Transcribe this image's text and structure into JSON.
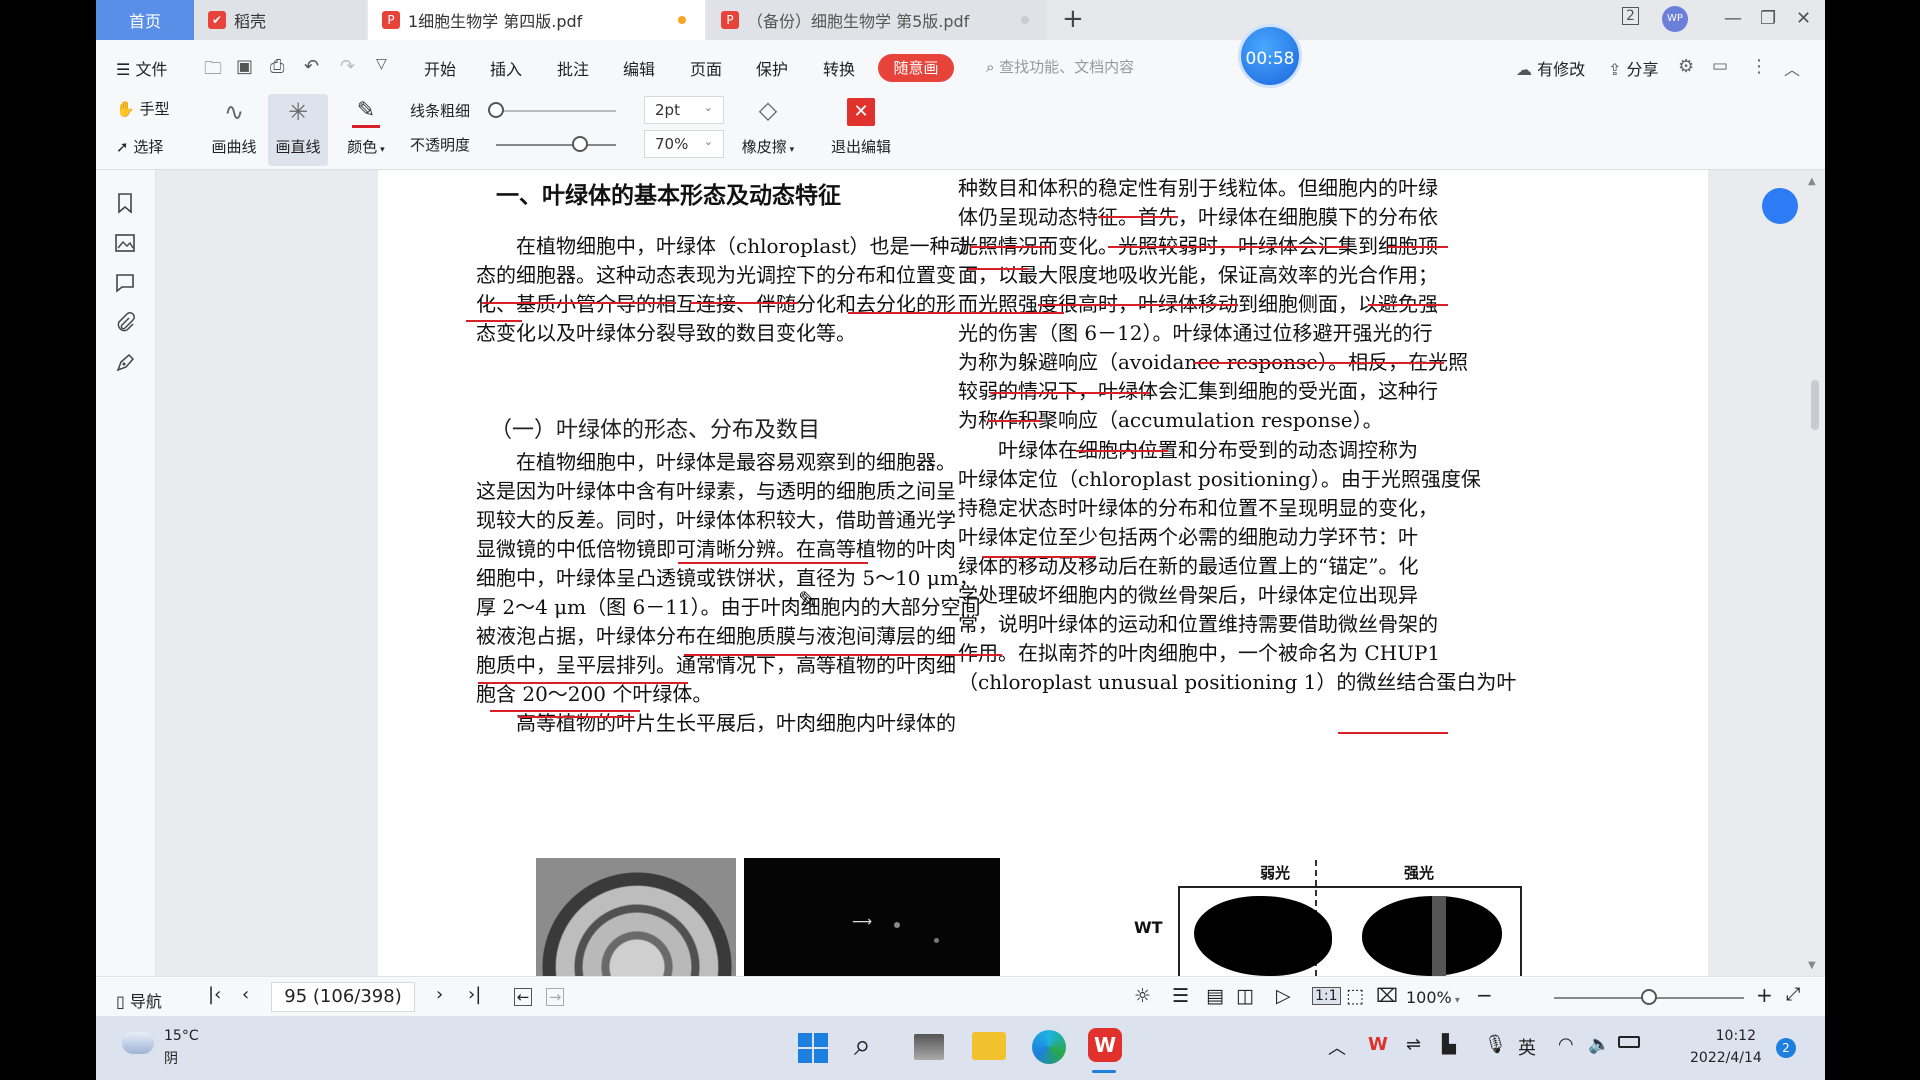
{
  "tabs": {
    "home": "首页",
    "daoke": "稻壳",
    "doc1": "1细胞生物学 第四版.pdf",
    "doc2": "（备份）细胞生物学 第5版.pdf"
  },
  "window": {
    "badge": "2"
  },
  "menu": {
    "file": "文件",
    "items": [
      "开始",
      "插入",
      "批注",
      "编辑",
      "页面",
      "保护",
      "转换"
    ],
    "active": "随意画",
    "search_placeholder": "查找功能、文档内容",
    "modified": "有修改",
    "share": "分享"
  },
  "timer": "00:58",
  "ribbon": {
    "hand": "手型",
    "select": "选择",
    "curve": "画曲线",
    "line": "画直线",
    "color": "颜色",
    "width_label": "线条粗细",
    "width_value": "2pt",
    "width_level": 0.0,
    "opacity_label": "不透明度",
    "opacity_value": "70%",
    "opacity_level": 0.7,
    "eraser": "橡皮擦",
    "exit": "退出编辑"
  },
  "doc": {
    "heading": "一、叶绿体的基本形态及动态特征",
    "left_para1": [
      "在植物细胞中，叶绿体（chloroplast）也是一种动",
      "态的细胞器。这种动态表现为光调控下的分布和位置变",
      "化、基质小管介导的相互连接、伴随分化和去分化的形",
      "态变化以及叶绿体分裂导致的数目变化等。"
    ],
    "subheading": "（一）叶绿体的形态、分布及数目",
    "left_para2": [
      "在植物细胞中，叶绿体是最容易观察到的细胞器。",
      "这是因为叶绿体中含有叶绿素，与透明的细胞质之间呈",
      "现较大的反差。同时，叶绿体体积较大，借助普通光学",
      "显微镜的中低倍物镜即可清晰分辨。在高等植物的叶肉",
      "细胞中，叶绿体呈凸透镜或铁饼状，直径为 5～10 μm，",
      "厚 2～4 μm（图 6－11）。由于叶肉细胞内的大部分空间",
      "被液泡占据，叶绿体分布在细胞质膜与液泡间薄层的细",
      "胞质中，呈平层排列。通常情况下，高等植物的叶肉细",
      "胞含 20～200 个叶绿体。",
      "高等植物的叶片生长平展后，叶肉细胞内叶绿体的"
    ],
    "right_para1": [
      "种数目和体积的稳定性有别于线粒体。但细胞内的叶绿",
      "体仍呈现动态特征。首先，叶绿体在细胞膜下的分布依",
      "光照情况而变化。光照较弱时，叶绿体会汇集到细胞顶",
      "面，以最大限度地吸收光能，保证高效率的光合作用；",
      "而光照强度很高时，叶绿体移动到细胞侧面，以避免强",
      "光的伤害（图 6－12）。叶绿体通过位移避开强光的行",
      "为称为躲避响应（avoidance response）。相反，在光照",
      "较弱的情况下，叶绿体会汇集到细胞的受光面，这种行",
      "为称作积聚响应（accumulation response）。"
    ],
    "right_para2": [
      "叶绿体在细胞内位置和分布受到的动态调控称为",
      "叶绿体定位（chloroplast positioning）。由于光照强度保",
      "持稳定状态时叶绿体的分布和位置不呈现明显的变化，",
      "叶绿体定位至少包括两个必需的细胞动力学环节：叶",
      "绿体的移动及移动后在新的最适位置上的“锚定”。化",
      "学处理破坏细胞内的微丝骨架后，叶绿体定位出现异",
      "常，说明叶绿体的运动和位置维持需要借助微丝骨架的",
      "作用。在拟南芥的叶肉细胞中，一个被命名为 CHUP1",
      "（chloroplast unusual positioning 1）的微丝结合蛋白为叶"
    ],
    "figure": {
      "weak": "弱光",
      "strong": "强光",
      "row": "WT"
    }
  },
  "status": {
    "nav": "导航",
    "page": "95 (106/398)",
    "zoom": "100%",
    "zoom_level": 0.5
  },
  "taskbar": {
    "temp": "15°C",
    "weather": "阴",
    "ime": "英",
    "time": "10:12",
    "date": "2022/4/14",
    "notif": "2"
  }
}
